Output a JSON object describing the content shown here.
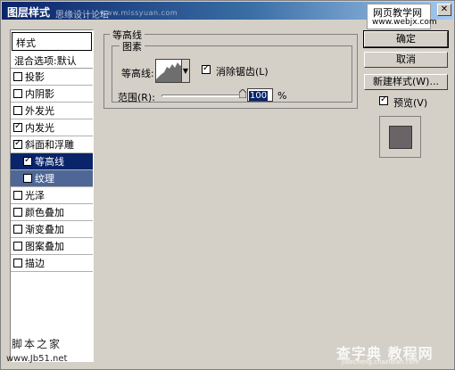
{
  "window": {
    "title": "图层样式"
  },
  "watermarks": {
    "title_overlay": "思缘设计论坛",
    "title_overlay_url": "www.missyuan.com",
    "box_line1": "网页教学网",
    "box_line2": "www.webjx.com",
    "bottom_left_line1": "脚本之家",
    "bottom_left_line2": "www.Jb51.net",
    "bottom_right_line1": "查字典 教程网",
    "bottom_right_line2": "jiaocheng.chazidian.com"
  },
  "close_glyph": "✕",
  "style_list": {
    "header": "样式",
    "blend": "混合选项:默认",
    "items": [
      {
        "label": "投影",
        "checked": false
      },
      {
        "label": "内阴影",
        "checked": false
      },
      {
        "label": "外发光",
        "checked": false
      },
      {
        "label": "内发光",
        "checked": true
      },
      {
        "label": "斜面和浮雕",
        "checked": true
      },
      {
        "label": "等高线",
        "checked": true
      },
      {
        "label": "纹理",
        "checked": false
      },
      {
        "label": "光泽",
        "checked": false
      },
      {
        "label": "颜色叠加",
        "checked": false
      },
      {
        "label": "渐变叠加",
        "checked": false
      },
      {
        "label": "图案叠加",
        "checked": false
      },
      {
        "label": "描边",
        "checked": false
      }
    ]
  },
  "panel": {
    "title": "等高线",
    "group_title": "图素",
    "contour_label": "等高线:",
    "antialias_label": "消除锯齿(L)",
    "antialias_checked": true,
    "range_label": "范围(R):",
    "range_value": "100",
    "range_unit": "%"
  },
  "buttons": {
    "ok": "确定",
    "cancel": "取消",
    "new_style": "新建样式(W)...",
    "preview_label": "预览(V)",
    "preview_checked": true
  },
  "colors": {
    "title_gradient_start": "#0a246a",
    "dialog_bg": "#d4d0c8",
    "selection": "#0a246a"
  }
}
